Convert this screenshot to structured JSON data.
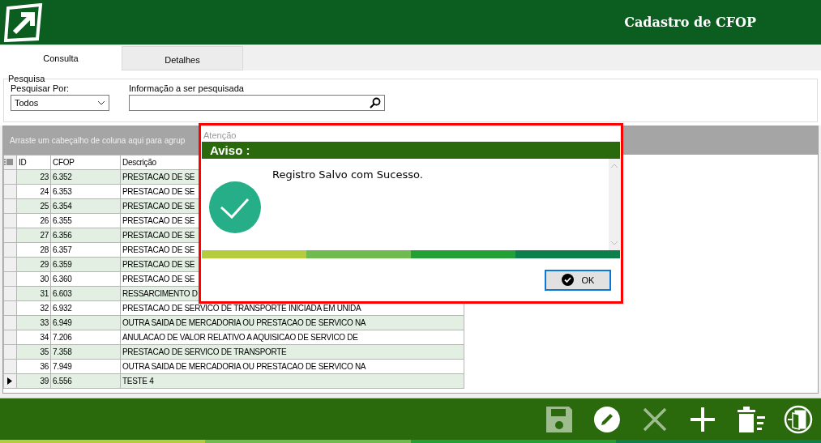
{
  "header": {
    "title": "Cadastro de CFOP"
  },
  "tabs": [
    {
      "label": "Consulta",
      "selected": true
    },
    {
      "label": "Detalhes",
      "selected": false
    }
  ],
  "search": {
    "group_title": "Pesquisa",
    "by_label": "Pesquisar Por:",
    "by_value": "Todos",
    "info_label": "Informação a ser pesquisada"
  },
  "grid": {
    "group_hint": "Arraste um cabeçalho de coluna aqui para agrup",
    "columns": [
      "ID",
      "CFOP",
      "Descrição"
    ],
    "rows": [
      {
        "id": "23",
        "cfop": "6.352",
        "descricao": "PRESTACAO DE SE",
        "current": false
      },
      {
        "id": "24",
        "cfop": "6.353",
        "descricao": "PRESTACAO DE SE",
        "current": false
      },
      {
        "id": "25",
        "cfop": "6.354",
        "descricao": "PRESTACAO DE SE",
        "current": false
      },
      {
        "id": "26",
        "cfop": "6.355",
        "descricao": "PRESTACAO DE SE",
        "current": false
      },
      {
        "id": "27",
        "cfop": "6.356",
        "descricao": "PRESTACAO DE SE",
        "current": false
      },
      {
        "id": "28",
        "cfop": "6.357",
        "descricao": "PRESTACAO DE SE",
        "current": false
      },
      {
        "id": "29",
        "cfop": "6.359",
        "descricao": "PRESTACAO DE SE",
        "current": false
      },
      {
        "id": "30",
        "cfop": "6.360",
        "descricao": "PRESTACAO DE SE",
        "current": false
      },
      {
        "id": "31",
        "cfop": "6.603",
        "descricao": "RESSARCIMENTO D",
        "current": false
      },
      {
        "id": "32",
        "cfop": "6.932",
        "descricao": "PRESTACAO DE SERVICO DE TRANSPORTE INICIADA EM UNIDA",
        "current": false
      },
      {
        "id": "33",
        "cfop": "6.949",
        "descricao": "OUTRA SAIDA DE MERCADORIA OU PRESTACAO DE SERVICO NA",
        "current": false
      },
      {
        "id": "34",
        "cfop": "7.206",
        "descricao": "ANULACAO DE VALOR RELATIVO A AQUISICAO DE SERVICO DE",
        "current": false
      },
      {
        "id": "35",
        "cfop": "7.358",
        "descricao": "PRESTACAO DE SERVICO DE TRANSPORTE",
        "current": false
      },
      {
        "id": "36",
        "cfop": "7.949",
        "descricao": "OUTRA SAIDA DE MERCADORIA OU PRESTACAO DE SERVICO NA",
        "current": false
      },
      {
        "id": "39",
        "cfop": "6.556",
        "descricao": "TESTE 4",
        "current": true
      }
    ]
  },
  "dialog": {
    "title": "Atenção",
    "heading": "Aviso :",
    "message": "Registro Salvo com Sucesso.",
    "button": "OK"
  },
  "toolbar": [
    {
      "kind": "save",
      "disabled": true
    },
    {
      "kind": "edit",
      "disabled": false
    },
    {
      "kind": "cancel",
      "disabled": true
    },
    {
      "kind": "add",
      "disabled": false
    },
    {
      "kind": "delete",
      "disabled": false
    },
    {
      "kind": "exit",
      "disabled": false
    }
  ]
}
